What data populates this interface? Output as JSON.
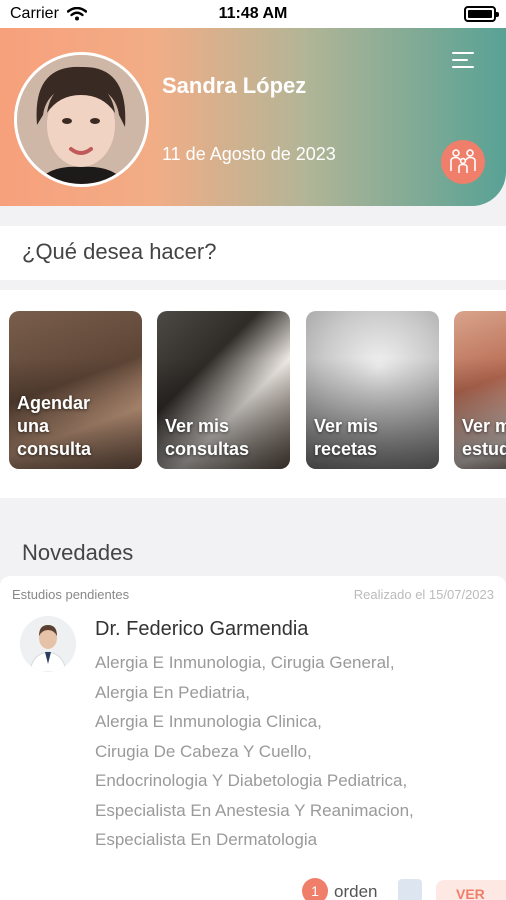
{
  "status_bar": {
    "carrier": "Carrier",
    "time": "11:48 AM"
  },
  "header": {
    "user_name": "Sandra López",
    "date": "11 de Agosto de 2023"
  },
  "question": "¿Qué desea hacer?",
  "actions": [
    {
      "label": "Agendar\nuna\nconsulta"
    },
    {
      "label": "Ver mis\nconsultas"
    },
    {
      "label": "Ver mis\nrecetas"
    },
    {
      "label": "Ver mis\nestudios"
    }
  ],
  "news": {
    "title": "Novedades",
    "card": {
      "tag": "Estudios pendientes",
      "date": "Realizado el 15/07/2023",
      "doctor": "Dr. Federico Garmendia",
      "specialties": [
        "Alergia E Inmunologia, Cirugia General,",
        "Alergia En Pediatria,",
        "Alergia E Inmunologia Clinica,",
        "Cirugia De Cabeza Y Cuello,",
        "Endocrinologia Y Diabetologia Pediatrica,",
        "Especialista En Anestesia Y Reanimacion,",
        "Especialista En Dermatologia"
      ],
      "orden_count": "1",
      "orden_label": "orden",
      "ver_label": "VER"
    }
  },
  "colors": {
    "accent": "#ef7f6a",
    "header_gradient_start": "#f7a07c",
    "header_gradient_end": "#58a295"
  },
  "icons": {
    "wifi": "wifi-icon",
    "battery": "battery-icon",
    "menu": "hamburger-menu-icon",
    "family": "family-icon",
    "document": "document-icon"
  }
}
